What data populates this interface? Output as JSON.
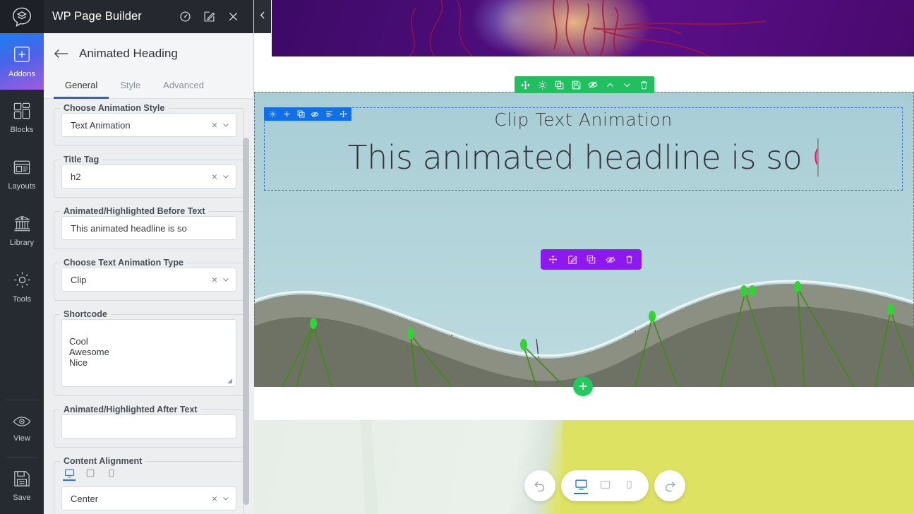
{
  "app": {
    "title": "WP Page Builder",
    "titlebar_icons": [
      "dashboard-icon",
      "edit-icon",
      "close-icon"
    ]
  },
  "rail": {
    "items": [
      {
        "label": "Addons",
        "icon": "plus-square-icon",
        "active": true
      },
      {
        "label": "Blocks",
        "icon": "blocks-icon",
        "active": false
      },
      {
        "label": "Layouts",
        "icon": "layouts-icon",
        "active": false
      },
      {
        "label": "Library",
        "icon": "library-icon",
        "active": false
      },
      {
        "label": "Tools",
        "icon": "gear-icon",
        "active": false
      }
    ],
    "bottom_items": [
      {
        "label": "View",
        "icon": "eye-icon"
      },
      {
        "label": "Save",
        "icon": "floppy-disk-icon"
      }
    ]
  },
  "panel": {
    "back_icon": "arrow-left-icon",
    "title": "Animated Heading",
    "tabs": [
      {
        "label": "General",
        "active": true
      },
      {
        "label": "Style",
        "active": false
      },
      {
        "label": "Advanced",
        "active": false
      }
    ],
    "fields": {
      "animation_style": {
        "label": "Choose Animation Style",
        "value": "Text Animation"
      },
      "title_tag": {
        "label": "Title Tag",
        "value": "h2"
      },
      "before_text": {
        "label": "Animated/Highlighted Before Text",
        "value": "This animated headline is so"
      },
      "text_anim_type": {
        "label": "Choose Text Animation Type",
        "value": "Clip"
      },
      "shortcode": {
        "label": "Shortcode",
        "value": "Cool\nAwesome\nNice"
      },
      "after_text": {
        "label": "Animated/Highlighted After Text",
        "value": "",
        "placeholder": ""
      },
      "content_align": {
        "label": "Content Alignment",
        "value": "Center",
        "devices": [
          {
            "name": "desktop",
            "active": true
          },
          {
            "name": "tablet",
            "active": false
          },
          {
            "name": "mobile",
            "active": false
          }
        ]
      }
    }
  },
  "collapse": {
    "icon": "chevron-left-icon"
  },
  "canvas": {
    "section_toolbar": {
      "color": "#20c060",
      "icons": [
        "move-icon",
        "gear-icon",
        "duplicate-icon",
        "save-icon",
        "eye-slash-icon",
        "chevron-up-icon",
        "chevron-down-icon",
        "trash-icon"
      ]
    },
    "row_toolbar": {
      "color": "#1170e8",
      "icons": [
        "gear-icon",
        "plus-icon",
        "duplicate-icon",
        "eye-slash-icon",
        "align-list-icon",
        "move-icon"
      ]
    },
    "module_toolbar": {
      "color": "#8e18f0",
      "icons": [
        "move-icon",
        "edit-icon",
        "duplicate-icon",
        "eye-slash-icon",
        "trash-icon"
      ]
    },
    "heading_small": "Clip Text Animation",
    "heading_large": "This animated headline is so",
    "clip_word_color": "#ff0d73",
    "add_button_icon": "plus-icon"
  },
  "bottom_bar": {
    "undo_icon": "undo-icon",
    "redo_icon": "redo-icon",
    "devices": [
      {
        "name": "desktop",
        "active": true
      },
      {
        "name": "tablet",
        "active": false
      },
      {
        "name": "mobile",
        "active": false
      }
    ]
  }
}
